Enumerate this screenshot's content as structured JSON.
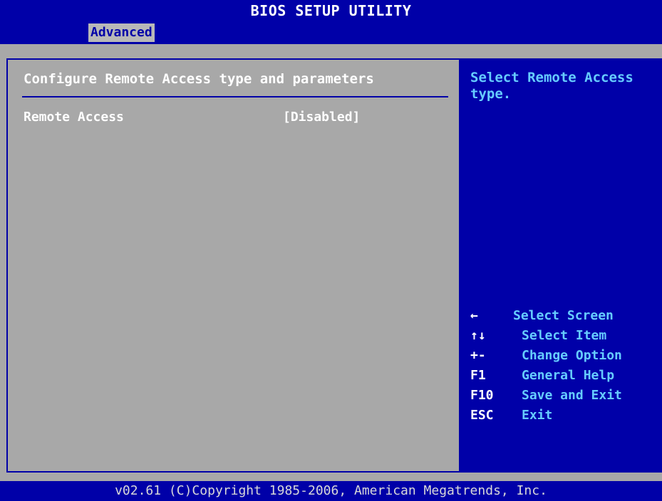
{
  "header": {
    "title": "BIOS SETUP UTILITY",
    "active_tab": "Advanced"
  },
  "main": {
    "heading": "Configure Remote Access type and parameters",
    "settings": [
      {
        "label": "Remote Access",
        "value": "[Disabled]"
      }
    ]
  },
  "help": {
    "text": "Select Remote Access type.",
    "keys": [
      {
        "key": "←",
        "desc": "Select Screen",
        "icon": "left-arrow-icon"
      },
      {
        "key": "↑↓",
        "desc": "Select Item",
        "icon": "up-down-arrow-icon"
      },
      {
        "key": "+-",
        "desc": "Change Option",
        "icon": "plus-minus-icon"
      },
      {
        "key": "F1",
        "desc": "General Help"
      },
      {
        "key": "F10",
        "desc": "Save and Exit"
      },
      {
        "key": "ESC",
        "desc": "Exit"
      }
    ]
  },
  "footer": {
    "copyright": "v02.61 (C)Copyright 1985-2006, American Megatrends, Inc."
  },
  "colors": {
    "bios_blue": "#0000a8",
    "panel_gray": "#a8a8a8",
    "help_cyan": "#66ccff",
    "text_white": "#ffffff"
  }
}
